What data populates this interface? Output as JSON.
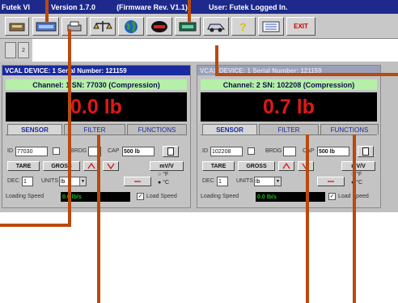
{
  "titlebar": {
    "app": "Futek VI",
    "version": "Version 1.7.0",
    "firmware": "(Firmware Rev. V1.1)",
    "user": "User: Futek Logged In."
  },
  "toolbar": {
    "buttons": [
      {
        "name": "device-icon"
      },
      {
        "name": "ieni-icon"
      },
      {
        "name": "print-icon"
      },
      {
        "name": "scale-icon"
      },
      {
        "name": "globe-icon"
      },
      {
        "name": "record-icon"
      },
      {
        "name": "display-icon"
      },
      {
        "name": "car-icon"
      },
      {
        "name": "help-icon"
      },
      {
        "name": "list-icon"
      }
    ],
    "exit_label": "EXIT"
  },
  "subtabs": [
    "",
    "2"
  ],
  "panels": [
    {
      "title": "VCAL DEVICE: 1 Serial Number: 121159",
      "channel": "Channel: 1 SN: 77030 (Compression)",
      "reading": "0.0 lb",
      "tabs": [
        "SENSOR",
        "FILTER",
        "FUNCTIONS"
      ],
      "id_label": "ID",
      "id_value": "77030",
      "brdg_label": "BRDG",
      "cap_label": "CAP",
      "cap_value": "500 lb",
      "tare": "TARE",
      "gross": "GROSS",
      "mv_v": "mV/V",
      "dec_label": "DEC",
      "dec_value": "1",
      "units_label": "UNITS",
      "units_value": "lb",
      "deg_f": "°F",
      "deg_c": "°C",
      "loading_speed_label": "Loading Speed",
      "loading_speed_value": "0.0 lb/s",
      "load_speed_label": "Load Speed"
    },
    {
      "title": "VCAL DEVICE: 1 Serial Number: 121159",
      "channel": "Channel: 2 SN: 102208 (Compression)",
      "reading": "0.7 lb",
      "tabs": [
        "SENSOR",
        "FILTER",
        "FUNCTIONS"
      ],
      "id_label": "ID",
      "id_value": "102208",
      "brdg_label": "BRDG",
      "cap_label": "CAP",
      "cap_value": "500 lb",
      "tare": "TARE",
      "gross": "GROSS",
      "mv_v": "mV/V",
      "dec_label": "DEC",
      "dec_value": "1",
      "units_label": "UNITS",
      "units_value": "lb",
      "deg_f": "°F",
      "deg_c": "°C",
      "loading_speed_label": "Loading Speed",
      "loading_speed_value": "0.0 lb/s",
      "load_speed_label": "Load Speed"
    }
  ],
  "colors": {
    "title_bar": "#1d2a8c",
    "channel_bar": "#b4f0a8",
    "reading_text": "#e01818",
    "callout_line": "#b84a0e"
  }
}
